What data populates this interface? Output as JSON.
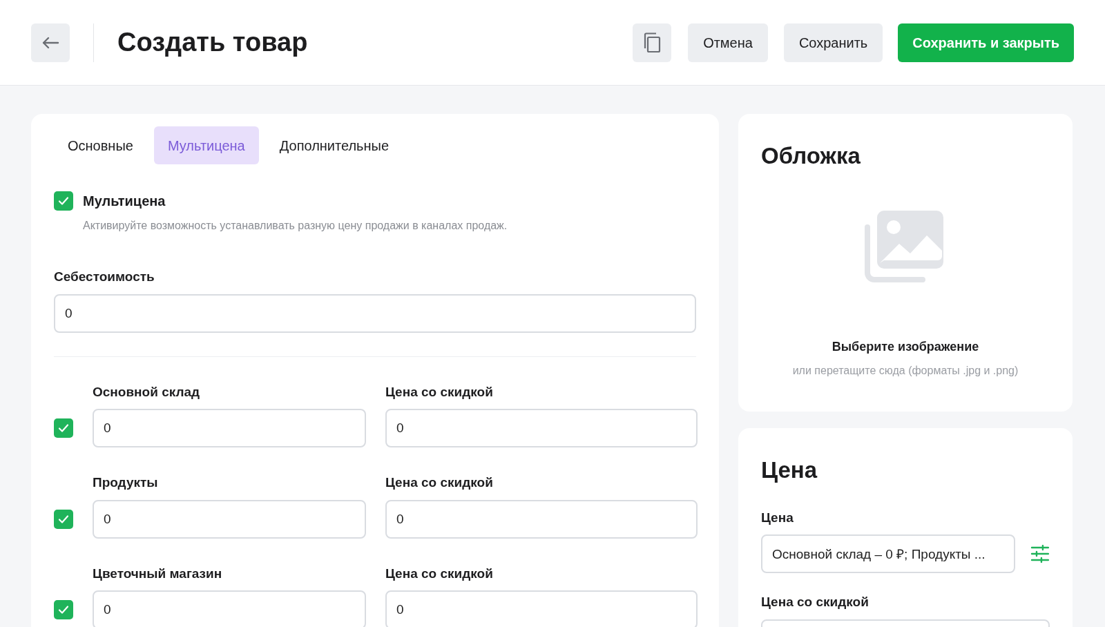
{
  "header": {
    "title": "Создать товар",
    "cancel": "Отмена",
    "save": "Сохранить",
    "save_close": "Сохранить и закрыть"
  },
  "tabs": [
    {
      "label": "Основные",
      "selected": false
    },
    {
      "label": "Мультицена",
      "selected": true
    },
    {
      "label": "Дополнительные",
      "selected": false
    }
  ],
  "multiprice": {
    "label": "Мультицена",
    "checked": true,
    "description": "Активируйте возможность устанавливать разную цену продажи в каналах продаж."
  },
  "cost": {
    "label": "Себестоимость",
    "value": "0"
  },
  "stores": [
    {
      "checked": true,
      "name": "Основной склад",
      "value": "0",
      "discount_label": "Цена со скидкой",
      "discount_value": "0"
    },
    {
      "checked": true,
      "name": "Продукты",
      "value": "0",
      "discount_label": "Цена со скидкой",
      "discount_value": "0"
    },
    {
      "checked": true,
      "name": "Цветочный магазин",
      "value": "0",
      "discount_label": "Цена со скидкой",
      "discount_value": "0"
    }
  ],
  "cover": {
    "title": "Обложка",
    "cta": "Выберите изображение",
    "hint": "или перетащите сюда (форматы .jpg и .png)"
  },
  "price": {
    "title": "Цена",
    "price_label": "Цена",
    "price_value": "Основной склад – 0 ₽; Продукты ...",
    "discount_label": "Цена со скидкой"
  }
}
